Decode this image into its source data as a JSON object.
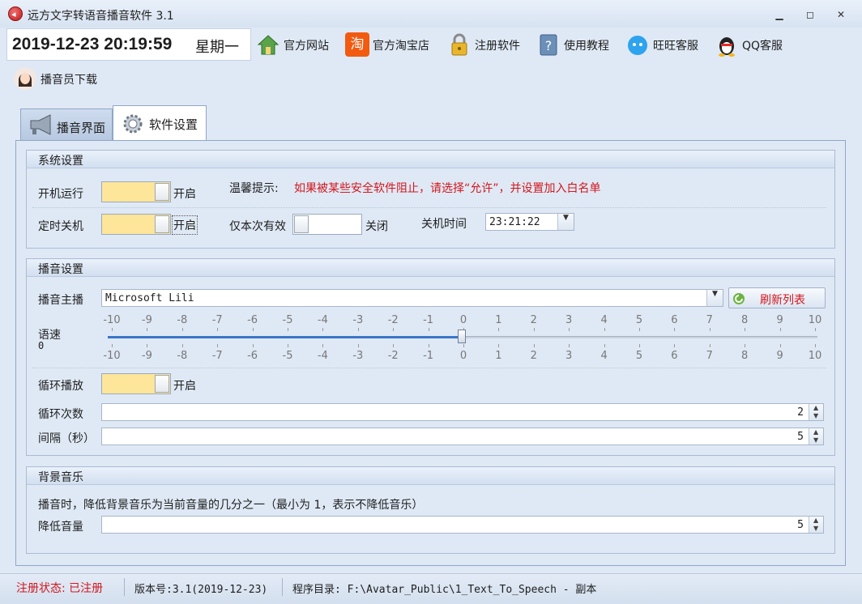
{
  "window": {
    "title": "远方文字转语音播音软件 3.1",
    "minimize": "▁",
    "maximize": "◻",
    "close": "✕"
  },
  "toolbar": {
    "date": "2019-12-23",
    "time": "20:19:59",
    "weekday": "星期一",
    "items": [
      {
        "label": "官方网站",
        "icon": "home-icon"
      },
      {
        "label": "官方淘宝店",
        "icon": "taobao-icon",
        "icon_text": "淘"
      },
      {
        "label": "注册软件",
        "icon": "lock-icon"
      },
      {
        "label": "使用教程",
        "icon": "help-book-icon"
      },
      {
        "label": "旺旺客服",
        "icon": "wangwang-icon"
      },
      {
        "label": "QQ客服",
        "icon": "qq-penguin-icon"
      }
    ],
    "anchor_download": "播音员下载"
  },
  "tabs": [
    {
      "label": "播音界面",
      "active": false
    },
    {
      "label": "软件设置",
      "active": true
    }
  ],
  "system": {
    "title": "系统设置",
    "autostart_label": "开机运行",
    "autostart_state": "开启",
    "tip_label": "温馨提示:",
    "tip_text": "如果被某些安全软件阻止，请选择“允许”，并设置加入白名单",
    "shutdown_label": "定时关机",
    "shutdown_state": "开启",
    "once_label": "仅本次有效",
    "once_state": "关闭",
    "shutdown_time_label": "关机时间",
    "shutdown_time": "23:21:22"
  },
  "broadcast": {
    "title": "播音设置",
    "anchor_label": "播音主播",
    "anchor_value": "Microsoft Lili",
    "refresh_label": "刷新列表",
    "speed_label": "语速",
    "speed_value": "0",
    "speed_ticks": [
      "-10",
      "-9",
      "-8",
      "-7",
      "-6",
      "-5",
      "-4",
      "-3",
      "-2",
      "-1",
      "0",
      "1",
      "2",
      "3",
      "4",
      "5",
      "6",
      "7",
      "8",
      "9",
      "10"
    ],
    "loop_label": "循环播放",
    "loop_state": "开启",
    "loop_count_label": "循环次数",
    "loop_count": "2",
    "interval_label": "间隔（秒）",
    "interval": "5"
  },
  "music": {
    "title": "背景音乐",
    "desc": "播音时，降低背景音乐为当前音量的几分之一（最小为 1，表示不降低音乐）",
    "reduce_label": "降低音量",
    "reduce_value": "5"
  },
  "status": {
    "reg_label": "注册状态:",
    "reg_value": "已注册",
    "version": "版本号:3.1(2019-12-23)",
    "dir": "程序目录: F:\\Avatar_Public\\1_Text_To_Speech - 副本"
  },
  "colors": {
    "accent_red": "#d4161d",
    "toggle_on": "#fde59a",
    "slider_fill": "#3a75c9"
  }
}
